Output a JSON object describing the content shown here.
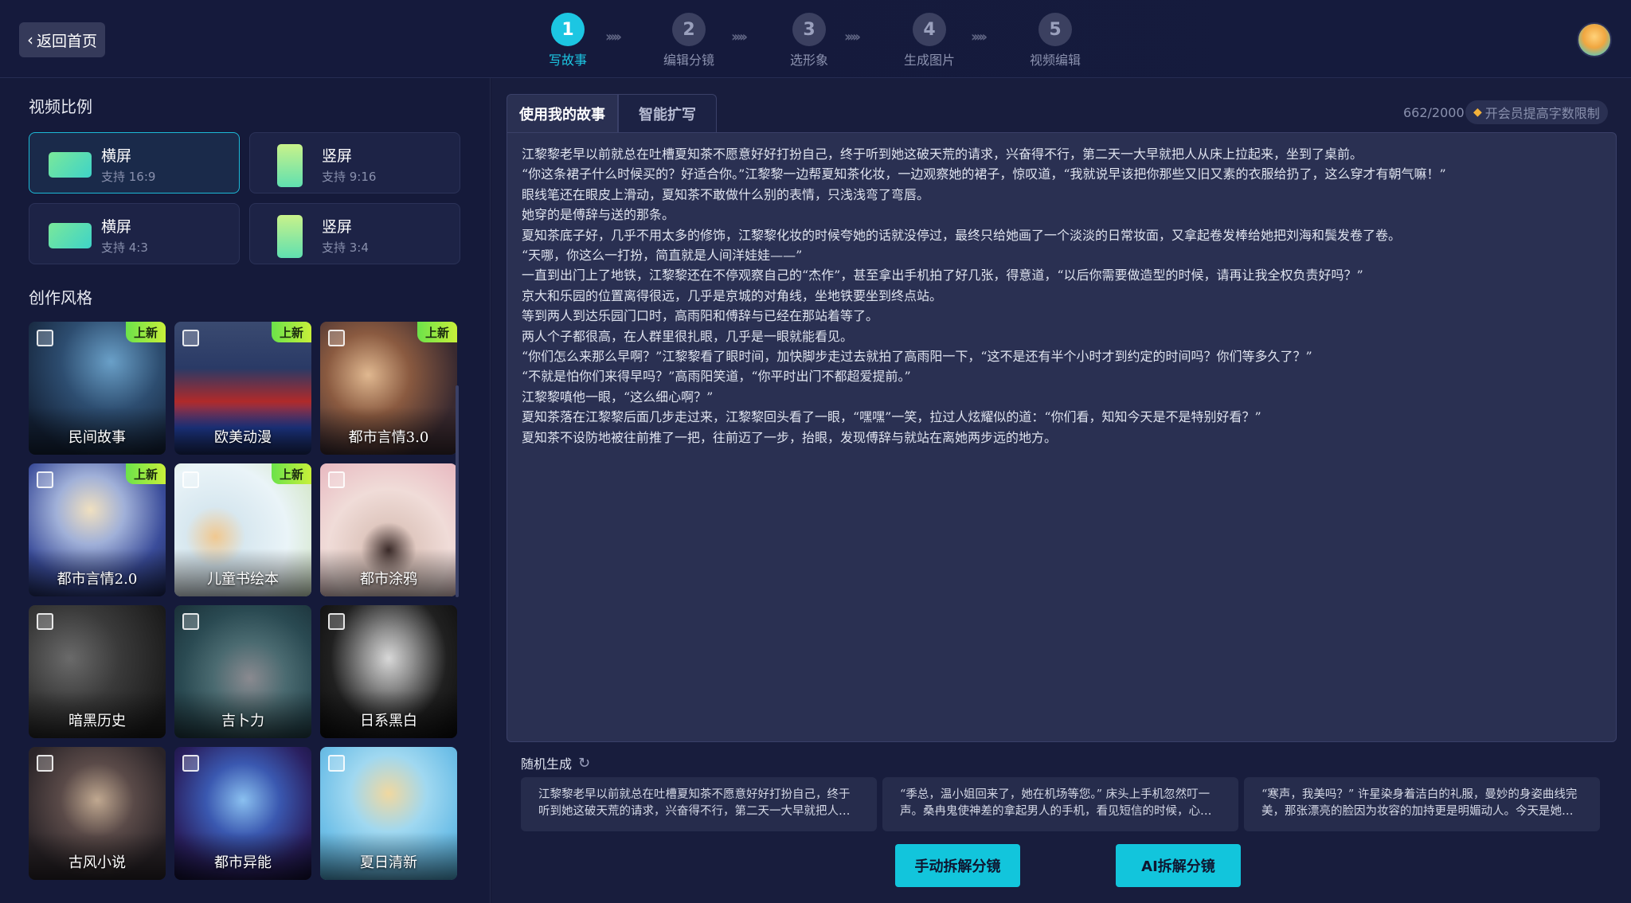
{
  "header": {
    "back_label": "返回首页",
    "steps": [
      {
        "num": "1",
        "label": "写故事",
        "active": true
      },
      {
        "num": "2",
        "label": "编辑分镜",
        "active": false
      },
      {
        "num": "3",
        "label": "选形象",
        "active": false
      },
      {
        "num": "4",
        "label": "生成图片",
        "active": false
      },
      {
        "num": "5",
        "label": "视频编辑",
        "active": false
      }
    ],
    "arrow_glyph": "›››››"
  },
  "left": {
    "ratio_title": "视频比例",
    "ratios": [
      {
        "name": "横屏",
        "desc": "支持 16:9",
        "orientation": "horizontal",
        "selected": true
      },
      {
        "name": "竖屏",
        "desc": "支持 9:16",
        "orientation": "vertical",
        "selected": false
      },
      {
        "name": "横屏",
        "desc": "支持 4:3",
        "orientation": "horizontal",
        "selected": false
      },
      {
        "name": "竖屏",
        "desc": "支持 3:4",
        "orientation": "vertical",
        "selected": false
      }
    ],
    "style_title": "创作风格",
    "new_badge": "上新",
    "styles": [
      {
        "name": "民间故事",
        "is_new": true
      },
      {
        "name": "欧美动漫",
        "is_new": true
      },
      {
        "name": "都市言情3.0",
        "is_new": true
      },
      {
        "name": "都市言情2.0",
        "is_new": true
      },
      {
        "name": "儿童书绘本",
        "is_new": true
      },
      {
        "name": "都市涂鸦",
        "is_new": false
      },
      {
        "name": "暗黑历史",
        "is_new": false
      },
      {
        "name": "吉卜力",
        "is_new": false
      },
      {
        "name": "日系黑白",
        "is_new": false
      },
      {
        "name": "古风小说",
        "is_new": false
      },
      {
        "name": "都市异能",
        "is_new": false
      },
      {
        "name": "夏日清新",
        "is_new": false
      }
    ]
  },
  "right": {
    "tabs": [
      {
        "label": "使用我的故事",
        "active": true
      },
      {
        "label": "智能扩写",
        "active": false
      }
    ],
    "counter": "662/2000",
    "vip_label": "开会员提高字数限制",
    "story_lines": [
      "江黎黎老早以前就总在吐槽夏知茶不愿意好好打扮自己，终于听到她这破天荒的请求，兴奋得不行，第二天一大早就把人从床上拉起来，坐到了桌前。",
      "“你这条裙子什么时候买的？好适合你。”江黎黎一边帮夏知茶化妆，一边观察她的裙子，惊叹道，“我就说早该把你那些又旧又素的衣服给扔了，这么穿才有朝气嘛！”",
      "眼线笔还在眼皮上滑动，夏知茶不敢做什么别的表情，只浅浅弯了弯唇。",
      "她穿的是傅辞与送的那条。",
      "夏知茶底子好，几乎不用太多的修饰，江黎黎化妆的时候夸她的话就没停过，最终只给她画了一个淡淡的日常妆面，又拿起卷发棒给她把刘海和鬓发卷了卷。",
      "“天哪，你这么一打扮，简直就是人间洋娃娃——”",
      "一直到出门上了地铁，江黎黎还在不停观察自己的“杰作”，甚至拿出手机拍了好几张，得意道，“以后你需要做造型的时候，请再让我全权负责好吗？”",
      "京大和乐园的位置离得很远，几乎是京城的对角线，坐地铁要坐到终点站。",
      "等到两人到达乐园门口时，高雨阳和傅辞与已经在那站着等了。",
      "两人个子都很高，在人群里很扎眼，几乎是一眼就能看见。",
      "“你们怎么来那么早啊？”江黎黎看了眼时间，加快脚步走过去就拍了高雨阳一下，“这不是还有半个小时才到约定的时间吗？你们等多久了？”",
      "“不就是怕你们来得早吗？”高雨阳笑道，“你平时出门不都超爱提前。”",
      "江黎黎嗔他一眼，“这么细心啊？”",
      "夏知茶落在江黎黎后面几步走过来，江黎黎回头看了一眼，“嘿嘿”一笑，拉过人炫耀似的道：“你们看，知知今天是不是特别好看？”",
      "夏知茶不设防地被往前推了一把，往前迈了一步，抬眼，发现傅辞与就站在离她两步远的地方。"
    ],
    "random_label": "随机生成",
    "samples": [
      "江黎黎老早以前就总在吐槽夏知茶不愿意好好打扮自己，终于听到她这破天荒的请求，兴奋得不行，第二天一大早就把人从床上拉起来，坐到了桌前。",
      "“季总，温小姐回来了，她在机场等您。” 床头上手机忽然叮一声。桑冉鬼使神差的拿起男人的手机，看见短信的时候，心跳仿佛漏了一拍。",
      "“寒声，我美吗？” 许星染身着洁白的礼服，曼妙的身姿曲线完美，那张漂亮的脸因为妆容的加持更是明媚动人。今天是她的婚礼。"
    ],
    "manual_split_label": "手动拆解分镜",
    "ai_split_label": "AI拆解分镜"
  },
  "colors": {
    "accent": "#1cc6e2",
    "badge": "#8fe83f",
    "background": "#141836"
  }
}
